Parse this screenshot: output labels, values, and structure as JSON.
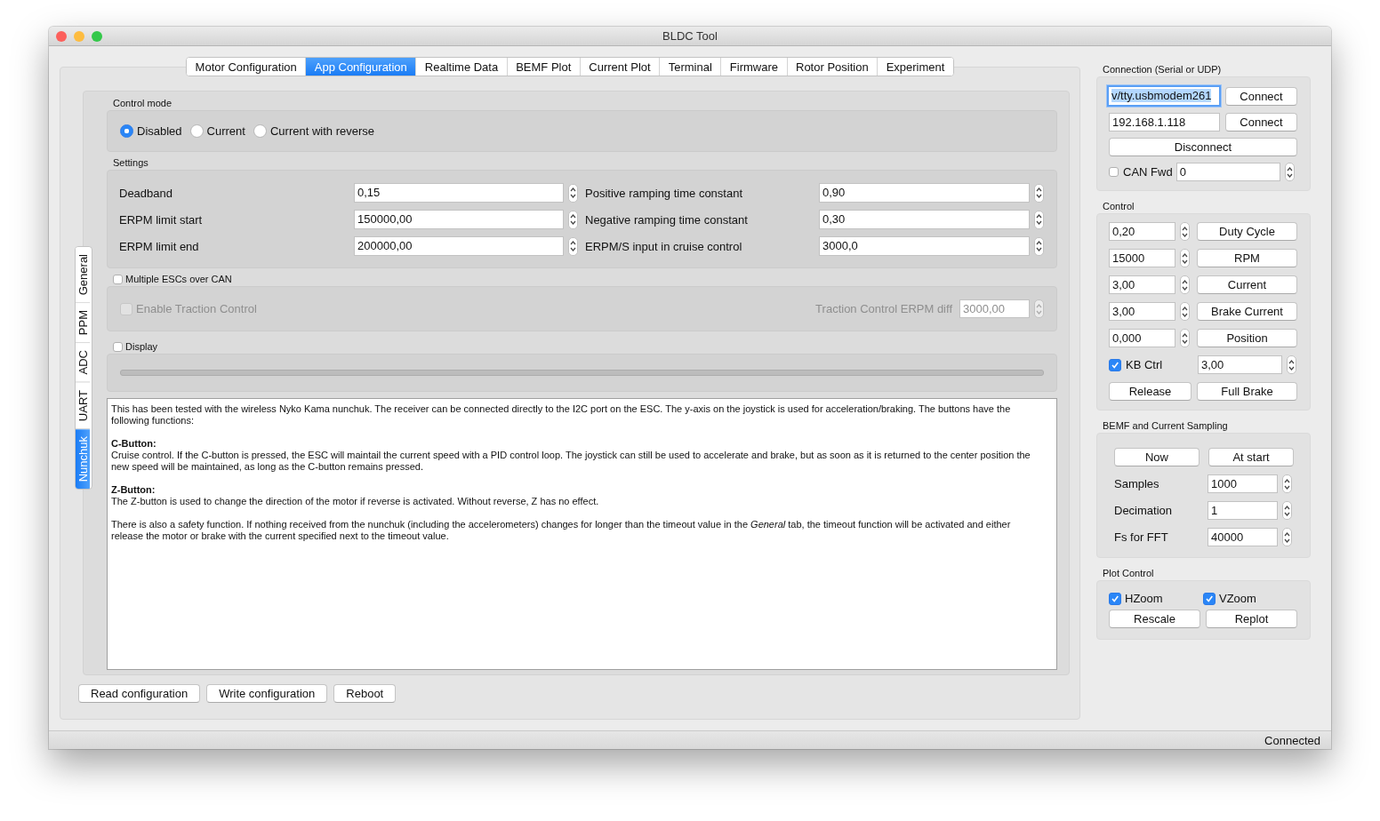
{
  "window": {
    "title": "BLDC Tool"
  },
  "tabs": [
    {
      "label": "Motor Configuration",
      "selected": false
    },
    {
      "label": "App Configuration",
      "selected": true
    },
    {
      "label": "Realtime Data",
      "selected": false
    },
    {
      "label": "BEMF Plot",
      "selected": false
    },
    {
      "label": "Current Plot",
      "selected": false
    },
    {
      "label": "Terminal",
      "selected": false
    },
    {
      "label": "Firmware",
      "selected": false
    },
    {
      "label": "Rotor Position",
      "selected": false
    },
    {
      "label": "Experiment",
      "selected": false
    }
  ],
  "side_tabs": [
    {
      "label": "General",
      "selected": false
    },
    {
      "label": "PPM",
      "selected": false
    },
    {
      "label": "ADC",
      "selected": false
    },
    {
      "label": "UART",
      "selected": false
    },
    {
      "label": "Nunchuk",
      "selected": true
    }
  ],
  "control_mode": {
    "label": "Control mode",
    "options": [
      {
        "label": "Disabled",
        "selected": true
      },
      {
        "label": "Current",
        "selected": false
      },
      {
        "label": "Current with reverse",
        "selected": false
      }
    ]
  },
  "settings": {
    "label": "Settings",
    "fields": [
      {
        "label": "Deadband",
        "value": "0,15"
      },
      {
        "label": "Positive ramping time constant",
        "value": "0,90"
      },
      {
        "label": "ERPM limit start",
        "value": "150000,00"
      },
      {
        "label": "Negative ramping time constant",
        "value": "0,30"
      },
      {
        "label": "ERPM limit end",
        "value": "200000,00"
      },
      {
        "label": "ERPM/S input in cruise control",
        "value": "3000,0"
      }
    ]
  },
  "multiple_escs": {
    "label": "Multiple ESCs over CAN",
    "checked": false
  },
  "traction_control": {
    "label": "Enable Traction Control",
    "checked": false,
    "disabled": true
  },
  "traction_diff": {
    "label": "Traction Control ERPM diff",
    "value": "3000,00",
    "disabled": true
  },
  "display": {
    "label": "Display",
    "checked": false
  },
  "description": [
    {
      "text": "This has been tested with the wireless Nyko Kama nunchuk. The receiver can be connected directly to the I2C port on the ESC. The y-axis on the joystick is used for acceleration/braking. The buttons have the following functions:"
    },
    {
      "heading": "C-Button:",
      "text": "Cruise control. If the C-button is pressed, the ESC will maintail the current speed with a PID control loop. The joystick can still be used to accelerate and brake, but as soon as it is returned to the center position the new speed will be maintained, as long as the C-button remains pressed."
    },
    {
      "heading": "Z-Button:",
      "text": "The Z-button is used to change the direction of the motor if reverse is activated. Without reverse, Z has no effect."
    },
    {
      "text": "There is also a safety function. If nothing received from the nunchuk (including the accelerometers) changes for longer than the timeout value in the *General* tab, the timeout function will be activated and either release the motor or brake with the current specified next to the timeout value."
    }
  ],
  "footer_buttons": [
    "Read configuration",
    "Write configuration",
    "Reboot"
  ],
  "connection": {
    "label": "Connection (Serial or UDP)",
    "serial": {
      "value": "v/tty.usbmodem261",
      "focused": true
    },
    "serial_button": "Connect",
    "udp": {
      "value": "192.168.1.118"
    },
    "udp_button": "Connect",
    "disconnect": "Disconnect",
    "can_fwd": {
      "label": "CAN Fwd",
      "checked": false,
      "value": "0"
    }
  },
  "control": {
    "label": "Control",
    "rows": [
      {
        "value": "0,20",
        "button": "Duty Cycle"
      },
      {
        "value": "15000",
        "button": "RPM"
      },
      {
        "value": "3,00",
        "button": "Current"
      },
      {
        "value": "3,00",
        "button": "Brake Current"
      },
      {
        "value": "0,000",
        "button": "Position"
      }
    ],
    "kb_ctrl": {
      "label": "KB Ctrl",
      "checked": true,
      "value": "3,00"
    },
    "buttons": [
      "Release",
      "Full Brake"
    ]
  },
  "sampling": {
    "label": "BEMF and Current Sampling",
    "buttons": [
      "Now",
      "At start"
    ],
    "fields": [
      {
        "label": "Samples",
        "value": "1000"
      },
      {
        "label": "Decimation",
        "value": "1"
      },
      {
        "label": "Fs for FFT",
        "value": "40000"
      }
    ]
  },
  "plot_control": {
    "label": "Plot Control",
    "checks": [
      {
        "label": "HZoom",
        "checked": true
      },
      {
        "label": "VZoom",
        "checked": true
      }
    ],
    "buttons": [
      "Rescale",
      "Replot"
    ]
  },
  "status_bar": {
    "text": "Connected"
  }
}
